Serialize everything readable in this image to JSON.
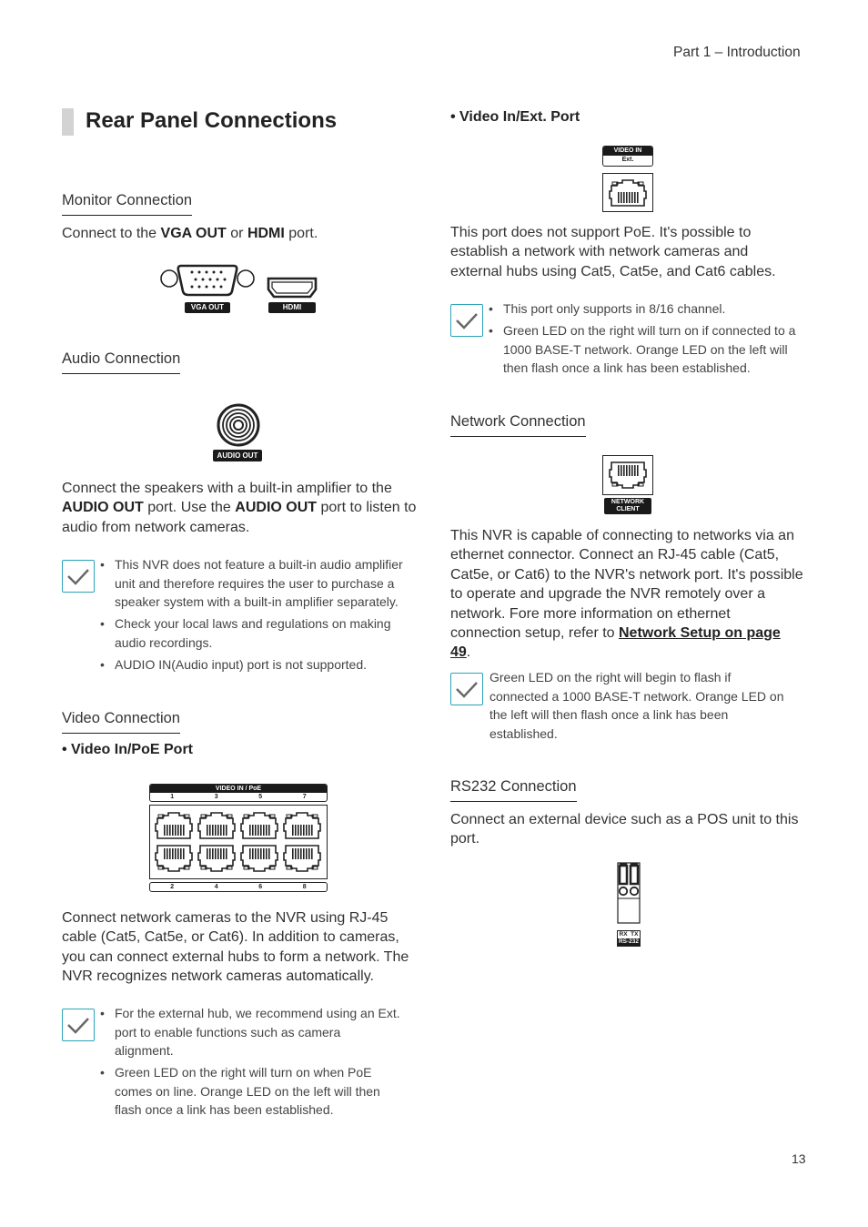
{
  "header": {
    "part": "Part 1 – Introduction"
  },
  "page_number": "13",
  "title": "Rear Panel Connections",
  "monitor": {
    "heading": "Monitor Connection",
    "text_pre": "Connect to the ",
    "bold1": "VGA OUT",
    "text_mid": " or ",
    "bold2": "HDMI",
    "text_post": " port.",
    "vga_label": "VGA OUT",
    "hdmi_label": "HDMI"
  },
  "audio": {
    "heading": "Audio Connection",
    "port_label": "AUDIO OUT",
    "p1": "Connect the speakers with a built-in amplifier to the ",
    "b1": "AUDIO OUT",
    "p2": " port. Use the ",
    "b2": "AUDIO OUT",
    "p3": " port to listen to audio from network cameras.",
    "notes": [
      "This NVR does not feature a built-in audio amplifier unit and therefore requires the user to purchase a speaker system with a built-in amplifier separately.",
      "Check your local laws and regulations on making audio recordings.",
      "AUDIO IN(Audio input) port is not supported."
    ]
  },
  "video": {
    "heading": "Video Connection",
    "sub": "Video In/PoE Port",
    "panel_label": "VIDEO IN / PoE",
    "top_numbers": [
      "1",
      "3",
      "5",
      "7"
    ],
    "bottom_numbers": [
      "2",
      "4",
      "6",
      "8"
    ],
    "text": "Connect network cameras to the NVR using RJ-45 cable (Cat5, Cat5e, or Cat6). In addition to cameras, you can connect external hubs to form a network. The NVR recognizes network cameras automatically.",
    "notes": [
      "For the external hub, we recommend using an Ext. port to enable functions such as camera alignment.",
      "Green LED on the right will turn on when PoE comes on line. Orange LED on the left will then flash once a link has been established."
    ]
  },
  "video_ext": {
    "sub": "Video In/Ext. Port",
    "label_top": "VIDEO IN",
    "label_bottom": "Ext.",
    "text": "This port does not support PoE. It's possible to establish a network with network cameras and external hubs using Cat5, Cat5e, and Cat6 cables.",
    "notes": [
      "This port only supports in 8/16 channel.",
      "Green LED on the right will turn on if connected to a 1000 BASE-T network. Orange LED on the left will then flash once a link has been established."
    ]
  },
  "network": {
    "heading": "Network Connection",
    "label_line1": "NETWORK",
    "label_line2": "CLIENT",
    "text": "This NVR is capable of connecting to networks via an ethernet connector. Connect an RJ-45 cable (Cat5, Cat5e, or Cat6) to the NVR's network port. It's possible to operate and upgrade the NVR remotely over a network. Fore more information on ethernet connection setup, refer to ",
    "link": "Network Setup on page 49",
    "text_end": ".",
    "note": "Green LED on the right will begin to flash if connected a 1000 BASE-T network. Orange LED on the left will then flash once a link has been established."
  },
  "rs232": {
    "heading": "RS232 Connection",
    "text": "Connect an external device such as a POS unit to this port.",
    "label_line1": "RX  TX",
    "label_line2": "RS-232"
  },
  "colors": {
    "note_icon_border": "#2aa3b8",
    "title_bar": "#d3d3d3"
  }
}
